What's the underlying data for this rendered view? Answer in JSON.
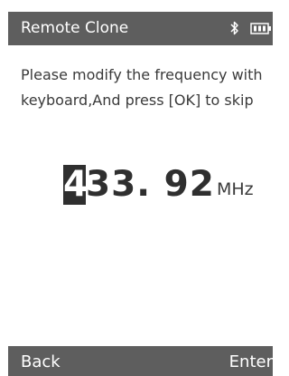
{
  "header": {
    "title": "Remote Clone",
    "status_icons": [
      "bluetooth-icon",
      "battery-icon"
    ]
  },
  "message": {
    "text": "Please modify the frequency with keyboard,And press [OK] to skip"
  },
  "frequency": {
    "cursor_digit": "4",
    "rest": "33. 92",
    "unit": "MHz"
  },
  "softkeys": {
    "left_label": "Back",
    "right_label": "Enter"
  },
  "colors": {
    "bar_background": "#5e5e5e",
    "text_dark": "#2f2f2f",
    "screen_background": "#ffffff"
  }
}
